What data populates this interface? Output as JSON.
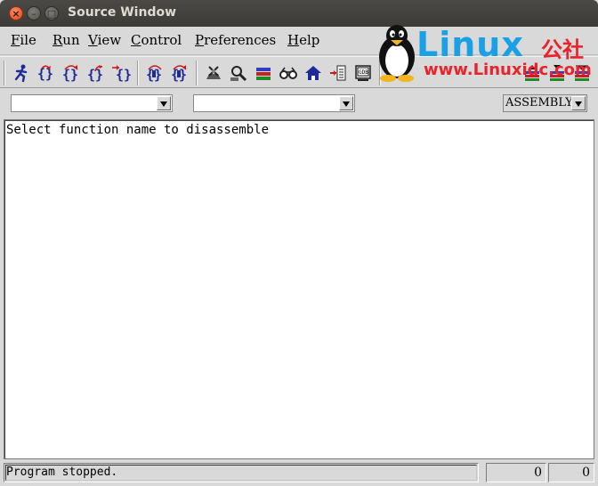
{
  "window": {
    "title": "Source Window",
    "close_glyph": "×",
    "min_glyph": "–",
    "max_glyph": "□"
  },
  "menu": [
    {
      "key": "F",
      "rest": "ile"
    },
    {
      "key": "R",
      "rest": "un"
    },
    {
      "key": "V",
      "rest": "iew"
    },
    {
      "key": "C",
      "rest": "ontrol"
    },
    {
      "key": "P",
      "rest": "references"
    },
    {
      "key": "H",
      "rest": "elp"
    }
  ],
  "toolbar": {
    "icons": [
      "run-icon",
      "step-icon",
      "next-icon",
      "finish-icon",
      "continue-icon",
      "stepi-icon",
      "nexti-icon",
      "registers-icon",
      "memory-icon",
      "stack-icon",
      "watch-icon",
      "home-icon",
      "goto-icon",
      "console-icon",
      "up-icon",
      "down-icon",
      "bottom-icon"
    ]
  },
  "combos": {
    "file_value": "",
    "function_value": "",
    "mode_value": "ASSEMBLY"
  },
  "source": {
    "message": "Select function name to disassemble"
  },
  "status": {
    "message": "Program stopped.",
    "num1": "0",
    "num2": "0"
  },
  "watermark": {
    "brand": "Linux",
    "brand_cn": "公社",
    "url": "www.Linuxidc.com"
  },
  "colors": {
    "titlebar": "#3c3b37",
    "close": "#df4a16",
    "brand_blue": "#1aa0e6",
    "brand_red": "#e8232a"
  }
}
